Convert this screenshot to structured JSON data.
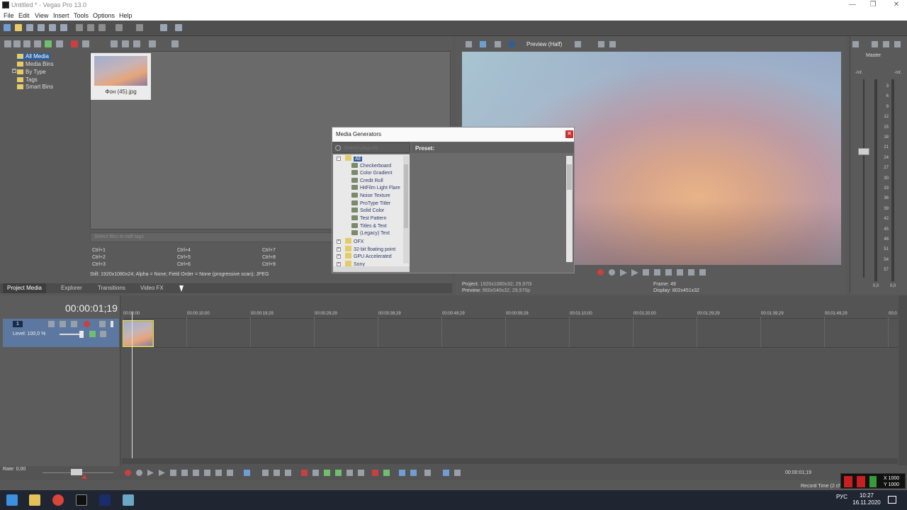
{
  "window": {
    "title": "Untitled * - Vegas Pro 13.0",
    "minimize": "—",
    "restore": "❐",
    "close": "✕"
  },
  "menu": [
    "File",
    "Edit",
    "View",
    "Insert",
    "Tools",
    "Options",
    "Help"
  ],
  "explorer_tree": {
    "items": [
      "All Media",
      "Media Bins",
      "By Type",
      "Tags",
      "Smart Bins"
    ],
    "selected": "All Media"
  },
  "media": {
    "thumbnail_label": "Фон (45).jpg",
    "tag_placeholder": "Select files to edit tags"
  },
  "shortcuts": [
    "Ctrl+1",
    "Ctrl+4",
    "Ctrl+7",
    "Ctrl+2",
    "Ctrl+5",
    "Ctrl+8",
    "Ctrl+3",
    "Ctrl+6",
    "Ctrl+9"
  ],
  "media_status": "Still: 1920x1080x24; Alpha = None; Field Order = None (progressive scan); JPEG",
  "tabs": [
    "Project Media",
    "Explorer",
    "Transitions",
    "Video FX"
  ],
  "active_tab": "Project Media",
  "preview": {
    "quality": "Preview (Half)",
    "project_label": "Project:",
    "project_value": "1920x1080x32; 29,970i",
    "preview_label": "Preview:",
    "preview_value": "960x540x32; 29,970p",
    "frame_label": "Frame:",
    "frame_value": "49",
    "display_label": "Display:",
    "display_value": "802x451x32"
  },
  "master": {
    "title": "Master",
    "inf_left": "-Inf.",
    "inf_right": "-Inf.",
    "db_labels": [
      "3",
      "6",
      "9",
      "12",
      "15",
      "18",
      "21",
      "24",
      "27",
      "30",
      "33",
      "36",
      "39",
      "42",
      "45",
      "48",
      "51",
      "54",
      "57"
    ],
    "bottom_left": "0,0",
    "bottom_right": "0,0"
  },
  "timeline": {
    "timecode": "00:00:01;19",
    "ruler": [
      "00:00:00",
      "00:00:10;00",
      "00:00:19;29",
      "00:00:29;29",
      "00:00:39;29",
      "00:00:49;29",
      "00:00:59;28",
      "00:01:10;00",
      "00:01:20;00",
      "00:01:29;29",
      "00:01:39;29",
      "00:01:49;29",
      "00:0"
    ],
    "track_number": "1",
    "level": "Level: 100,0 %"
  },
  "transport": {
    "rate": "Rate: 0,00",
    "position": "00:00:01;19",
    "record_time": "Record Time (2 ch"
  },
  "coords": {
    "x": "X 1000",
    "y": "Y 1000"
  },
  "dialog": {
    "title": "Media Generators",
    "search_placeholder": "Search plug-ins",
    "preset_label": "Preset:",
    "root": "All",
    "generators": [
      "Checkerboard",
      "Color Gradient",
      "Credit Roll",
      "HitFilm Light Flare",
      "Noise Texture",
      "ProType Titler",
      "Solid Color",
      "Test Pattern",
      "Titles & Text",
      "(Legacy) Text"
    ],
    "folders": [
      "OFX",
      "32-bit floating point",
      "GPU Accelerated",
      "Sony"
    ]
  },
  "taskbar": {
    "tray_lang": "РУС",
    "time": "10:27",
    "date": "16.11.2020"
  },
  "colors": {
    "selection": "#2d5d9a",
    "track_header": "#5c78a0",
    "clip_border": "#e8e24a",
    "dialog_close": "#c83232"
  }
}
